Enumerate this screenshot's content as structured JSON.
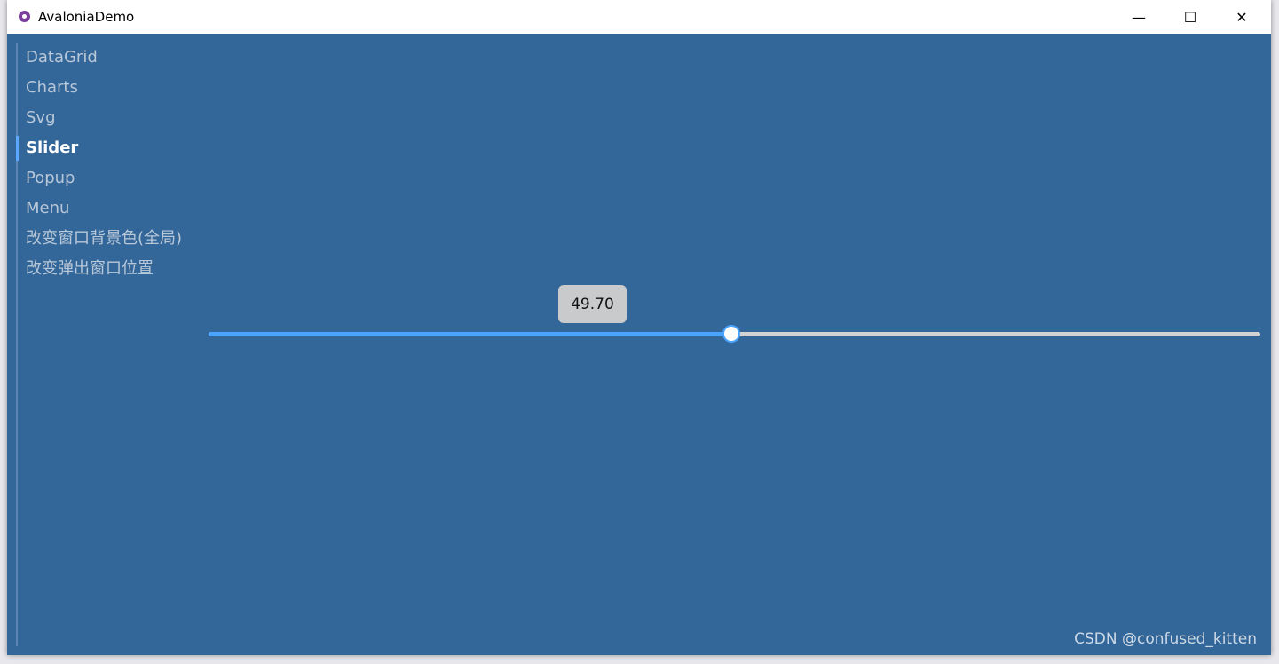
{
  "window": {
    "title": "AvaloniaDemo",
    "minimize": "—",
    "maximize": "☐",
    "close": "✕"
  },
  "colors": {
    "background": "#336699",
    "accent": "#4aa3ff",
    "track": "#d3d3d3"
  },
  "sidebar": {
    "items": [
      {
        "label": "DataGrid",
        "selected": false
      },
      {
        "label": "Charts",
        "selected": false
      },
      {
        "label": "Svg",
        "selected": false
      },
      {
        "label": "Slider",
        "selected": true
      },
      {
        "label": "Popup",
        "selected": false
      },
      {
        "label": "Menu",
        "selected": false
      },
      {
        "label": "改变窗口背景色(全局)",
        "selected": false
      },
      {
        "label": "改变弹出窗口位置",
        "selected": false
      }
    ]
  },
  "slider": {
    "value": 49.7,
    "min": 0,
    "max": 100,
    "tooltip": "49.70"
  },
  "watermark": "CSDN @confused_kitten"
}
